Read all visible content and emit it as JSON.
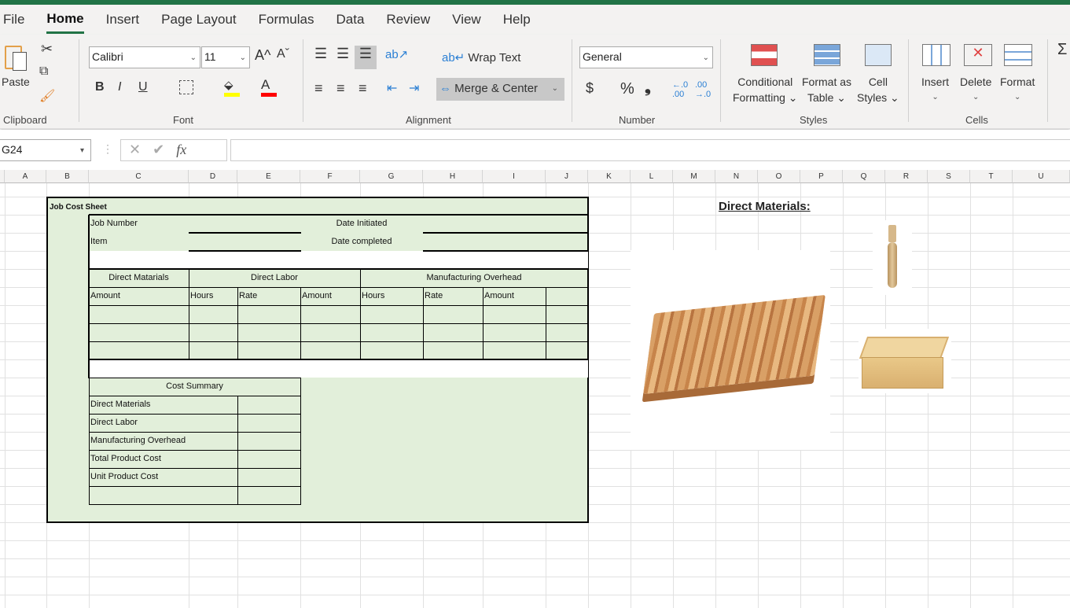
{
  "menu": {
    "tabs": [
      "File",
      "Home",
      "Insert",
      "Page Layout",
      "Formulas",
      "Data",
      "Review",
      "View",
      "Help"
    ],
    "active": "Home"
  },
  "ribbon": {
    "clipboard": {
      "label": "Clipboard",
      "paste": "Paste"
    },
    "font": {
      "label": "Font",
      "name": "Calibri",
      "size": "11",
      "bold": "B",
      "italic": "I",
      "underline": "U",
      "grow": "A^",
      "shrink": "Aˇ",
      "font_color": "A",
      "fill_color_hex": "#ffff00",
      "font_color_hex": "#ff0000"
    },
    "alignment": {
      "label": "Alignment",
      "wrap_text": "Wrap Text",
      "merge_center": "Merge & Center"
    },
    "number": {
      "label": "Number",
      "format": "General",
      "currency": "$",
      "percent": "%",
      "comma": "❟"
    },
    "styles": {
      "label": "Styles",
      "conditional": "Conditional",
      "conditional2": "Formatting",
      "format_table": "Format as",
      "format_table2": "Table",
      "cell_styles": "Cell",
      "cell_styles2": "Styles"
    },
    "cells": {
      "label": "Cells",
      "insert": "Insert",
      "delete": "Delete",
      "format": "Format"
    }
  },
  "formula_bar": {
    "name_box": "G24",
    "value": "",
    "fx": "fx"
  },
  "columns": [
    "A",
    "B",
    "C",
    "D",
    "E",
    "F",
    "G",
    "H",
    "I",
    "J",
    "K",
    "L",
    "M",
    "N",
    "O",
    "P",
    "Q",
    "R",
    "S",
    "T",
    "U"
  ],
  "sheet": {
    "title": "Job Cost Sheet",
    "job_number": "Job Number",
    "item": "Item",
    "date_initiated": "Date  Initiated",
    "date_completed": "Date completed",
    "headers": {
      "dm": "Direct Matarials",
      "dl": "Direct Labor",
      "mo": "Manufacturing Overhead"
    },
    "subheaders": [
      "Amount",
      "Hours",
      "Rate",
      "Amount",
      "Hours",
      "Rate",
      "Amount"
    ],
    "summary_title": "Cost Summary",
    "summary_rows": [
      "Direct Materials",
      "Direct Labor",
      "Manufacturing Overhead",
      "Total Product Cost",
      "Unit Product Cost",
      ""
    ],
    "direct_materials_heading": "Direct Materials:"
  }
}
